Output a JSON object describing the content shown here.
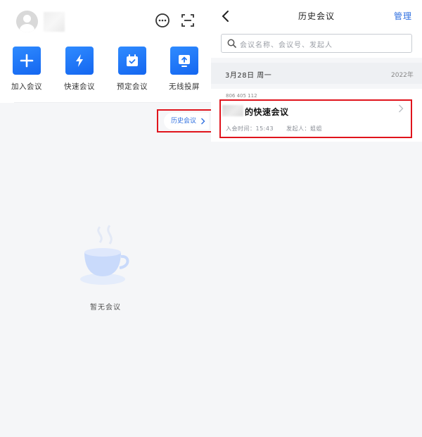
{
  "left": {
    "top_icons": [
      "chat-icon",
      "scan-icon"
    ],
    "actions": [
      {
        "label": "加入会议",
        "icon": "plus-icon"
      },
      {
        "label": "快速会议",
        "icon": "lightning-icon"
      },
      {
        "label": "预定会议",
        "icon": "calendar-check-icon"
      },
      {
        "label": "无线投屏",
        "icon": "screen-cast-icon"
      }
    ],
    "history_button": "历史会议",
    "empty_text": "暂无会议"
  },
  "right": {
    "title": "历史会议",
    "manage": "管理",
    "search_placeholder": "会议名称、会议号、发起人",
    "date_header": {
      "date": "3月28日  周一",
      "year": "2022年"
    },
    "meeting": {
      "meeting_id": "806 405 112",
      "title": "的快速会议",
      "join_time": "入会时间：15:43",
      "organizer": "发起人：姐姐"
    }
  },
  "colors": {
    "accent": "#2f6fe0",
    "tile": "#1f77f5",
    "highlight": "#e0141c",
    "background": "#f5f6f8"
  }
}
